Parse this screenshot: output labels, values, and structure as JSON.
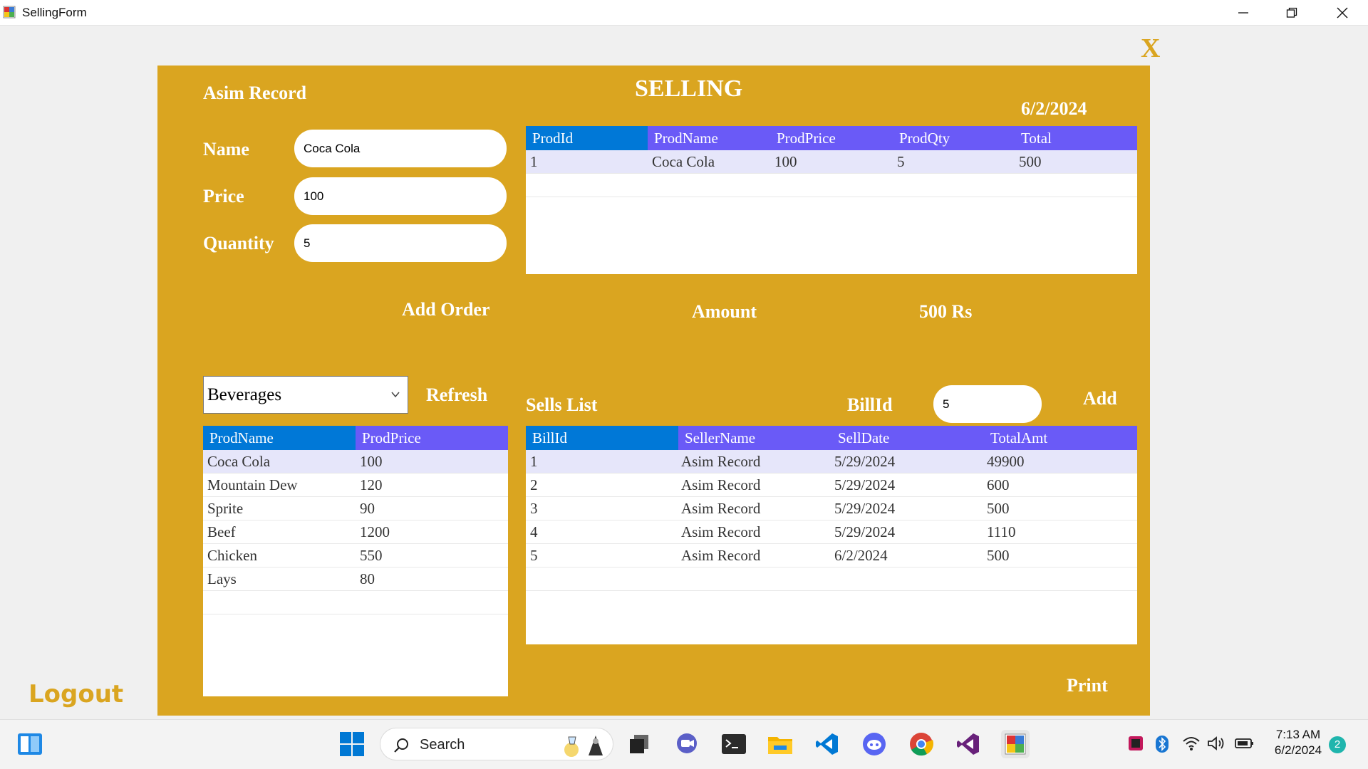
{
  "window": {
    "title": "SellingForm"
  },
  "form": {
    "close_label": "X",
    "logout_label": "Logout",
    "seller_name": "Asim Record",
    "heading": "SELLING",
    "date": "6/2/2024",
    "labels": {
      "name": "Name",
      "price": "Price",
      "quantity": "Quantity"
    },
    "inputs": {
      "name": "Coca Cola",
      "price": "100",
      "quantity": "5"
    },
    "add_order_label": "Add Order",
    "amount_label": "Amount",
    "amount_value": "500 Rs",
    "category_selected": "Beverages",
    "refresh_label": "Refresh",
    "sells_list_label": "Sells List",
    "billid_label": "BillId",
    "billid_value": "5",
    "add_label": "Add",
    "print_label": "Print"
  },
  "order_grid": {
    "headers": [
      "ProdId",
      "ProdName",
      "ProdPrice",
      "ProdQty",
      "Total"
    ],
    "rows": [
      [
        "1",
        "Coca Cola",
        "100",
        "5",
        "500"
      ]
    ]
  },
  "products_grid": {
    "headers": [
      "ProdName",
      "ProdPrice"
    ],
    "rows": [
      [
        "Coca Cola",
        "100"
      ],
      [
        "Mountain Dew",
        "120"
      ],
      [
        "Sprite",
        "90"
      ],
      [
        "Beef",
        "1200"
      ],
      [
        "Chicken",
        "550"
      ],
      [
        "Lays",
        "80"
      ]
    ]
  },
  "bills_grid": {
    "headers": [
      "BillId",
      "SellerName",
      "SellDate",
      "TotalAmt"
    ],
    "rows": [
      [
        "1",
        "Asim Record",
        "5/29/2024",
        "49900"
      ],
      [
        "2",
        "Asim Record",
        "5/29/2024",
        "600"
      ],
      [
        "3",
        "Asim Record",
        "5/29/2024",
        "500"
      ],
      [
        "4",
        "Asim Record",
        "5/29/2024",
        "1110"
      ],
      [
        "5",
        "Asim Record",
        "6/2/2024",
        "500"
      ]
    ]
  },
  "colors": {
    "panel": "#DAA520",
    "grid_header": "#6A5AF7",
    "grid_header_first": "#0078D7",
    "selected_row": "#E6E6FA"
  },
  "taskbar": {
    "search_label": "Search",
    "time": "7:13 AM",
    "date": "6/2/2024",
    "notification_count": "2",
    "icons": [
      "start-icon",
      "search-icon",
      "task-view-icon",
      "teams-icon",
      "terminal-icon",
      "file-explorer-icon",
      "vscode-icon",
      "discord-icon",
      "chrome-icon",
      "visual-studio-icon",
      "winforms-app-icon"
    ],
    "tray_icons": [
      "app-tray-icon",
      "bluetooth-icon",
      "wifi-icon",
      "volume-icon",
      "battery-icon"
    ]
  }
}
